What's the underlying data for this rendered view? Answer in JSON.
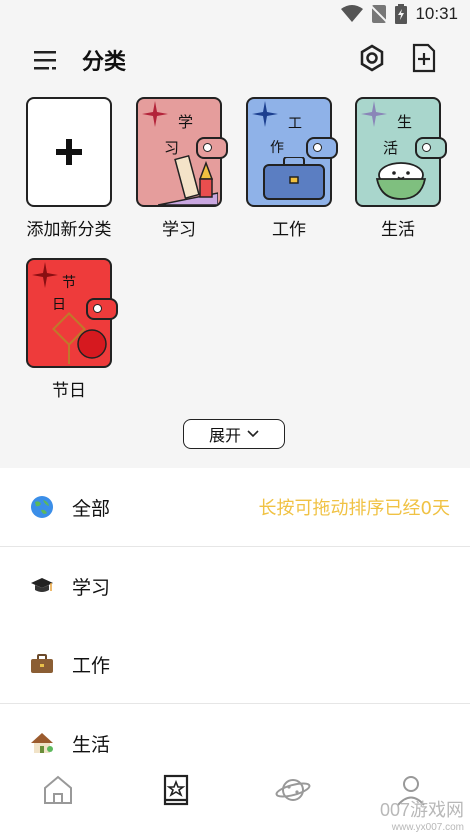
{
  "status": {
    "time": "10:31"
  },
  "header": {
    "title": "分类"
  },
  "categories": [
    {
      "label": "添加新分类",
      "icon": "plus-icon"
    },
    {
      "label": "学习",
      "cover_text": [
        "学",
        "习"
      ],
      "color": "#e59d9c"
    },
    {
      "label": "工作",
      "cover_text": [
        "工",
        "作"
      ],
      "color": "#8fb2e8"
    },
    {
      "label": "生活",
      "cover_text": [
        "生",
        "活"
      ],
      "color": "#a9d6cc"
    },
    {
      "label": "节日",
      "cover_text": [
        "节",
        "日"
      ],
      "color": "#ee3b3b"
    }
  ],
  "expand": {
    "label": "展开"
  },
  "list": [
    {
      "label": "全部",
      "icon": "globe-icon",
      "hint": "长按可拖动排序已经0天"
    },
    {
      "label": "学习",
      "icon": "graduation-cap-icon"
    },
    {
      "label": "工作",
      "icon": "briefcase-icon"
    },
    {
      "label": "生活",
      "icon": "house-icon"
    }
  ],
  "nav": [
    {
      "name": "home-icon"
    },
    {
      "name": "notebook-icon",
      "active": true
    },
    {
      "name": "planet-icon"
    },
    {
      "name": "profile-icon"
    }
  ],
  "watermark": {
    "main": "007游戏网",
    "url": "www.yx007.com"
  },
  "colors": {
    "accent": "#f0c244",
    "background": "#f5f5f5"
  }
}
